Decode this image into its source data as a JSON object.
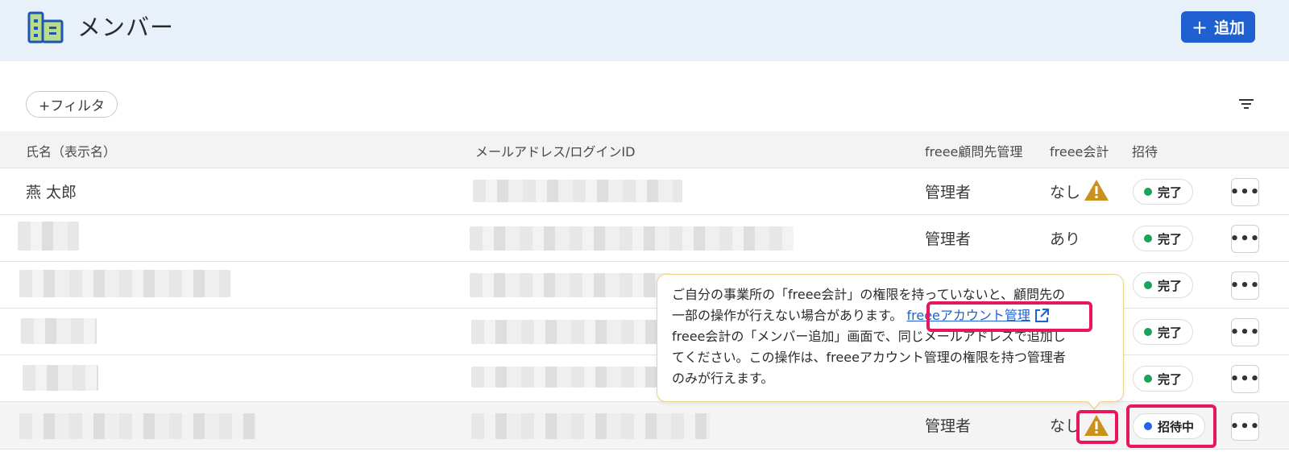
{
  "header": {
    "title": "メンバー",
    "add_button": "追加",
    "add_plus": "+"
  },
  "toolbar": {
    "filter_label": "+フィルタ"
  },
  "table": {
    "columns": [
      "氏名（表示名）",
      "メールアドレス/ログインID",
      "freee顧問先管理",
      "freee会計",
      "招待"
    ],
    "rows": [
      {
        "name": "燕 太郎",
        "admin": "管理者",
        "accounting": "なし",
        "status": "完了"
      },
      {
        "name": "",
        "admin": "管理者",
        "accounting": "あり",
        "status": "完了"
      },
      {
        "name": "",
        "admin": "",
        "accounting": "",
        "status": "完了"
      },
      {
        "name": "",
        "admin": "",
        "accounting": "",
        "status": "完了"
      },
      {
        "name": "",
        "admin": "",
        "accounting": "",
        "status": "完了"
      },
      {
        "name": "",
        "admin": "管理者",
        "accounting": "なし",
        "status": "招待中"
      }
    ],
    "more_glyph": "•••"
  },
  "tooltip": {
    "line1": "ご自分の事業所の「freee会計」の権限を持っていないと、顧問先の",
    "line2": "一部の操作が行えない場合があります。",
    "link": "freeeアカウント管理",
    "line3": "freee会計の「メンバー追加」画面で、同じメールアドレスで追加し",
    "line4": "てください。この操作は、freeeアカウント管理の権限を持つ管理者",
    "line5": "のみが行えます。"
  },
  "colors": {
    "primary": "#1f5fcf",
    "done_dot": "#1aa35a",
    "inviting_dot": "#2563eb",
    "warning": "#c8921c",
    "highlight": "#e8155f"
  },
  "icons": [
    "building-icon",
    "sort-icon",
    "warning-icon",
    "external-link-icon",
    "more-icon"
  ]
}
